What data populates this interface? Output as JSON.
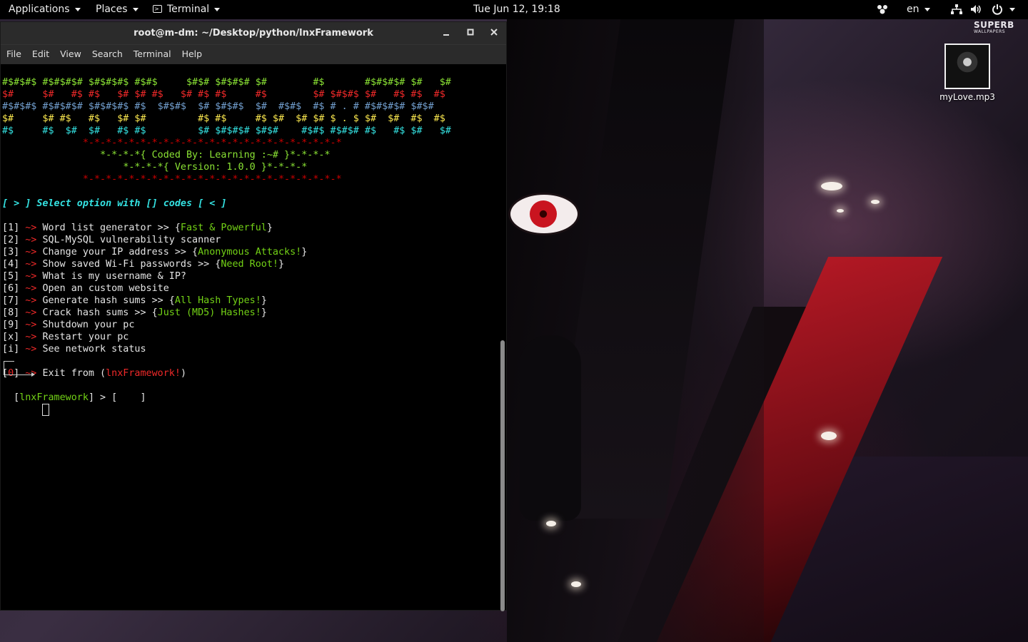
{
  "topbar": {
    "applications": "Applications",
    "places": "Places",
    "terminal": "Terminal",
    "clock": "Tue Jun 12, 19:18",
    "lang": "en"
  },
  "wallpaper": {
    "brand": "SUPERB",
    "brand_sub": "WALLPAPERS"
  },
  "desktop_icon": {
    "label": "myLove.mp3"
  },
  "window": {
    "title": "root@m-dm: ~/Desktop/python/lnxFramework",
    "menu": [
      "File",
      "Edit",
      "View",
      "Search",
      "Terminal",
      "Help"
    ]
  },
  "terminal": {
    "banner": [
      "#$#$#$ #$#$#$# $#$#$#$ #$#$     $#$# $#$#$# $#        #$       #$#$#$# $#   $#",
      "$#     $#   #$ #$   $# $# #$   $# #$ #$     #$        $# $#$#$ $#   #$ #$  #$",
      "#$#$#$ #$#$#$# $#$#$#$ #$  $#$#$  $# $#$#$  $#  #$#$  #$ # . # #$#$#$# $#$#",
      "$#     $# #$   #$   $# $#         #$ #$     #$ $#  $# $# $ . $ $#  $#  #$  #$",
      "#$     #$  $#  $#   #$ #$         $# $#$#$# $#$#    #$#$ #$#$# #$   #$ $#   $#"
    ],
    "border": "*-*-*-*-*-*-*-*-*-*-*-*-*-*-*-*-*-*-*-*-*-*-*",
    "coded_by": "*-*-*-*{ Coded By: Learning :~# }*-*-*-*",
    "version": "*-*-*-*{ Version: 1.0.0 }*-*-*-*",
    "select_prompt": "[ > ] Select option with [] codes [ < ]",
    "options": [
      {
        "key": "1",
        "text": "Word list generator >> {",
        "extra": "Fast & Powerful",
        "close": "}"
      },
      {
        "key": "2",
        "text": "SQL-MySQL vulnerability scanner",
        "extra": "",
        "close": ""
      },
      {
        "key": "3",
        "text": "Change your IP address >> {",
        "extra": "Anonymous Attacks!",
        "close": "}"
      },
      {
        "key": "4",
        "text": "Show saved Wi-Fi passwords >> {",
        "extra": "Need Root!",
        "close": "}"
      },
      {
        "key": "5",
        "text": "What is my username & IP?",
        "extra": "",
        "close": ""
      },
      {
        "key": "6",
        "text": "Open an custom website",
        "extra": "",
        "close": ""
      },
      {
        "key": "7",
        "text": "Generate hash sums >> {",
        "extra": "All Hash Types!",
        "close": "}"
      },
      {
        "key": "8",
        "text": "Crack hash sums >> {",
        "extra": "Just (MD5) Hashes!",
        "close": "}"
      },
      {
        "key": "9",
        "text": "Shutdown your pc",
        "extra": "",
        "close": ""
      },
      {
        "key": "x",
        "text": "Restart your pc",
        "extra": "",
        "close": ""
      },
      {
        "key": "i",
        "text": "See network status",
        "extra": "",
        "close": ""
      }
    ],
    "exit_key": "0",
    "exit_text": "Exit from (",
    "exit_name": "lnxFramework!",
    "exit_close": ")",
    "prompt_name": "lnxFramework",
    "prompt_rest": "] > [    ]"
  }
}
